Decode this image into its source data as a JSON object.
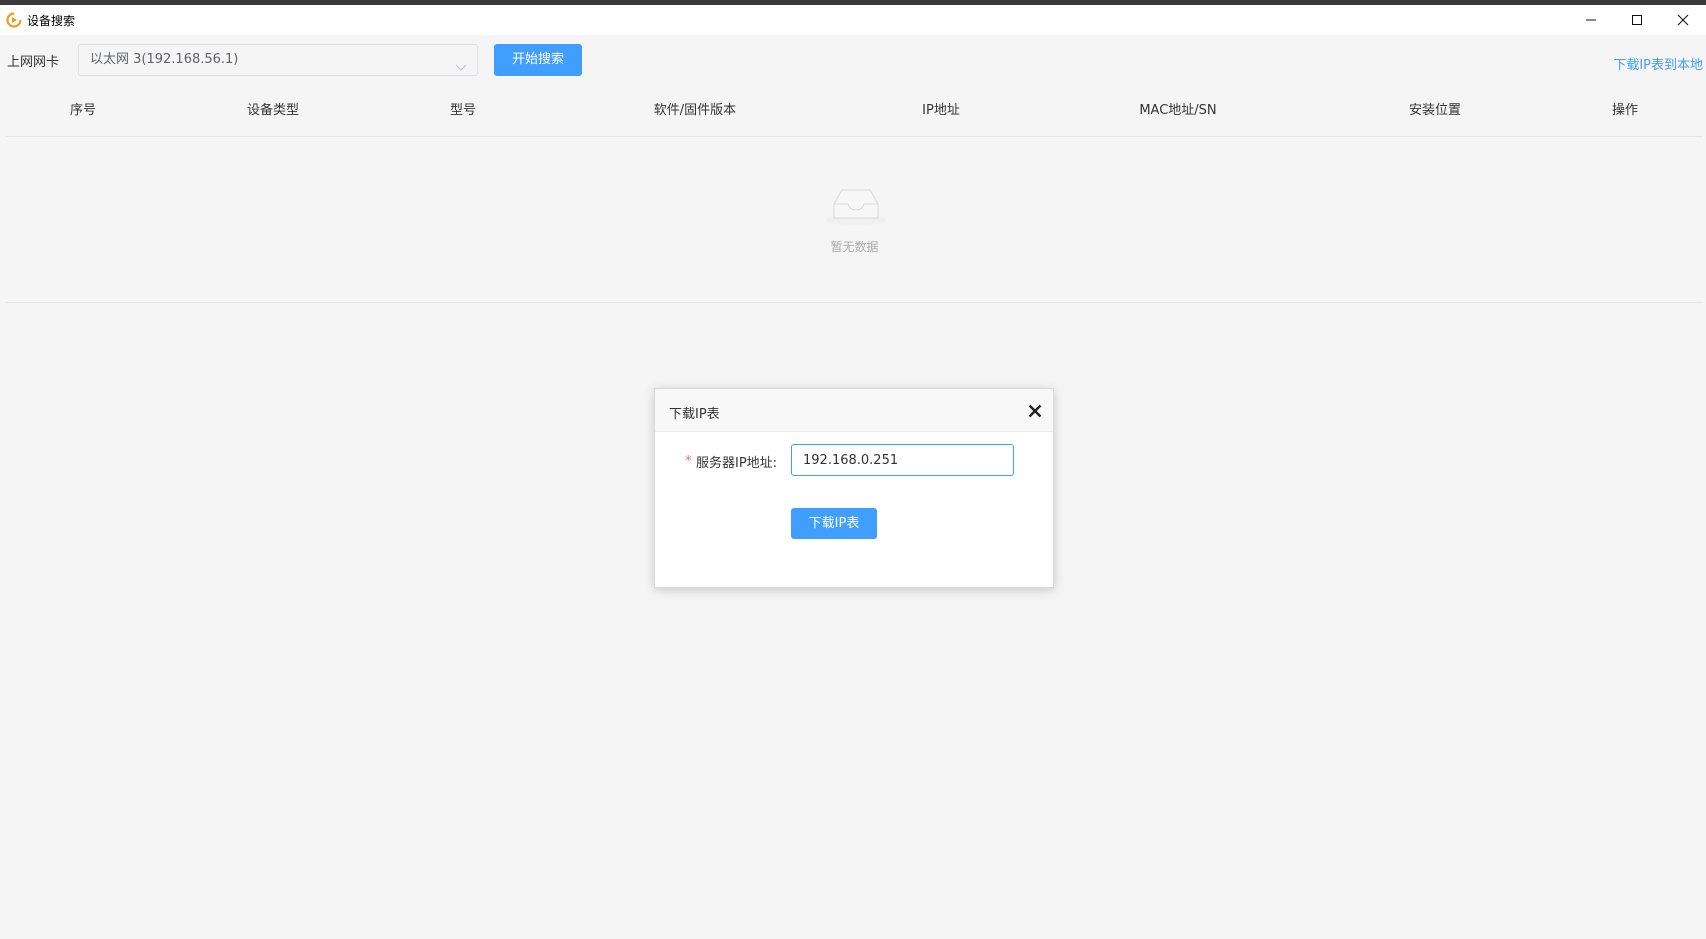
{
  "window": {
    "title": "设备搜索",
    "icon": "app-logo-icon",
    "controls": [
      "minimize-icon",
      "maximize-icon",
      "close-icon"
    ]
  },
  "toolbar": {
    "nic_label": "上网网卡",
    "nic_selected": "以太网 3(192.168.56.1)",
    "search_button": "开始搜索",
    "download_link": "下载IP表到本地"
  },
  "table": {
    "columns": [
      "序号",
      "设备类型",
      "型号",
      "软件/固件版本",
      "IP地址",
      "MAC地址/SN",
      "安装位置",
      "操作"
    ],
    "empty_text": "暂无数据"
  },
  "dialog": {
    "title": "下载IP表",
    "required_mark": "*",
    "field_label": "服务器IP地址:",
    "ip_value": "192.168.0.251",
    "button": "下载IP表"
  },
  "colors": {
    "accent": "#409eff",
    "required": "#f56c6c",
    "background": "#f5f5f5"
  }
}
